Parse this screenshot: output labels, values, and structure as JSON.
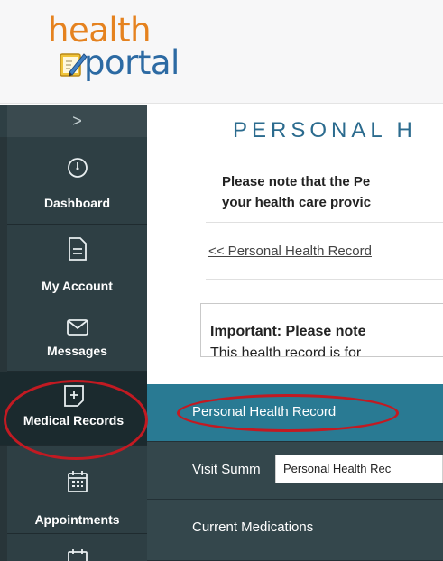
{
  "logo": {
    "line1": "health",
    "line2": "portal"
  },
  "sidebar": {
    "toggle_glyph": ">",
    "items": [
      {
        "label": "Dashboard",
        "icon": "dashboard-gauge-icon"
      },
      {
        "label": "My Account",
        "icon": "document-icon"
      },
      {
        "label": "Messages",
        "icon": "envelope-icon"
      },
      {
        "label": "Medical Records",
        "icon": "medical-record-plus-icon"
      },
      {
        "label": "Appointments",
        "icon": "calendar-icon"
      }
    ]
  },
  "main": {
    "title": "PERSONAL H",
    "note_line1": "Please note that the Pe",
    "note_line2": "your health care provic",
    "back_link": "<< Personal Health Record",
    "important_title": "Important: Please note",
    "important_body": "This health record is for"
  },
  "submenu": {
    "items": [
      {
        "label": "Personal Health Record"
      },
      {
        "label": "Visit Summ"
      },
      {
        "label": "Current Medications"
      }
    ],
    "tooltip": "Personal Health Rec"
  },
  "colors": {
    "annotation": "#c21a22",
    "active_submenu": "#297a93",
    "sidebar": "#2e3f44"
  }
}
